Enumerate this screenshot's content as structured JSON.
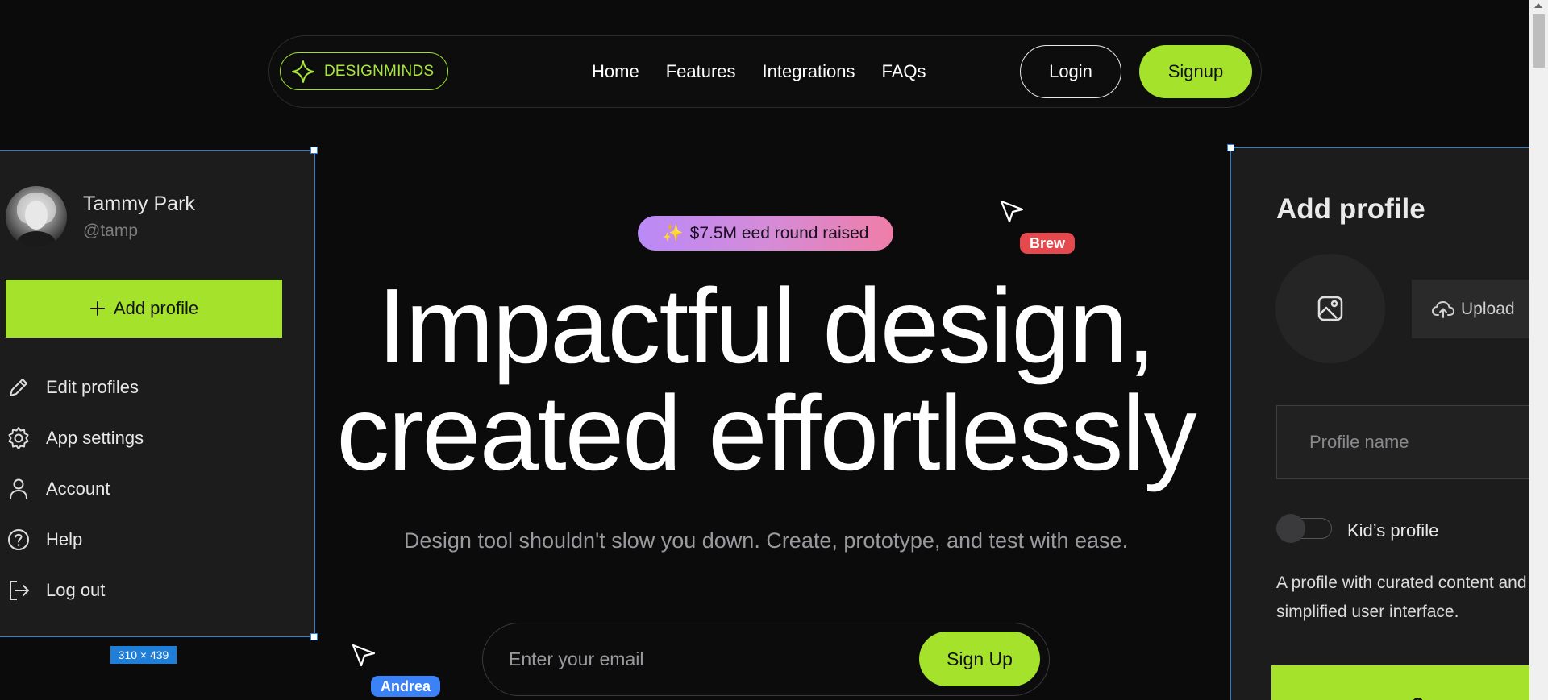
{
  "navbar": {
    "logo_text": "DESIGNMINDS",
    "links": [
      "Home",
      "Features",
      "Integrations",
      "FAQs"
    ],
    "login_label": "Login",
    "signup_label": "Signup"
  },
  "hero": {
    "badge_icon": "✨",
    "badge_text": "$7.5M eed round raised",
    "title_line1": "Impactful design,",
    "title_line2": "created effortlessly",
    "subtitle": "Design tool shouldn't slow you down. Create, prototype, and test with ease.",
    "email_placeholder": "Enter your email",
    "email_button": "Sign Up"
  },
  "left_panel": {
    "user_name": "Tammy Park",
    "user_handle": "@tamp",
    "add_profile_label": "Add profile",
    "menu": [
      {
        "label": "Edit profiles",
        "icon": "pencil-icon"
      },
      {
        "label": "App settings",
        "icon": "gear-icon"
      },
      {
        "label": "Account",
        "icon": "user-icon"
      },
      {
        "label": "Help",
        "icon": "help-icon"
      },
      {
        "label": "Log out",
        "icon": "logout-icon"
      }
    ],
    "size_label": "310 × 439"
  },
  "right_panel": {
    "title": "Add profile",
    "upload_label": "Upload",
    "profile_name_placeholder": "Profile name",
    "kids_profile_label": "Kid’s profile",
    "description": "A profile with curated content and a simplified user interface.",
    "save_label": "Save"
  },
  "cursors": [
    {
      "name": "Brew",
      "color": "#e5484d"
    },
    {
      "name": "Andrea",
      "color": "#3b82f6"
    }
  ],
  "colors": {
    "accent": "#a5e22b",
    "background": "#0b0b0c",
    "panel": "#1c1c1d",
    "selection": "#2a7fd4"
  }
}
